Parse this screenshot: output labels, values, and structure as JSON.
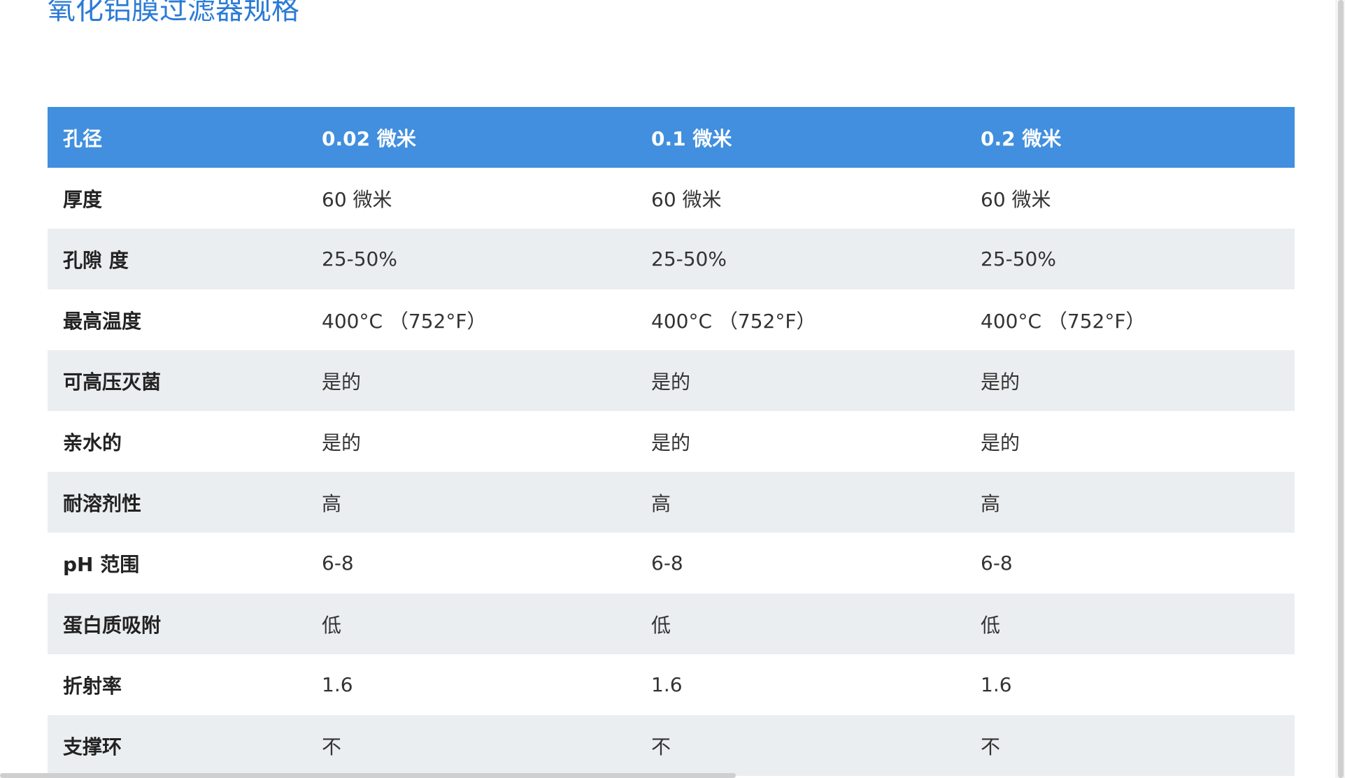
{
  "page": {
    "title": "氧化铝膜过滤器规格"
  },
  "table": {
    "header": [
      "孔径",
      "0.02 微米",
      "0.1 微米",
      "0.2 微米"
    ],
    "rows": [
      [
        "厚度",
        "60 微米",
        "60 微米",
        "60 微米"
      ],
      [
        "孔隙 度",
        "25-50%",
        "25-50%",
        "25-50%"
      ],
      [
        "最高温度",
        "400°C （752°F）",
        "400°C （752°F）",
        "400°C （752°F）"
      ],
      [
        "可高压灭菌",
        "是的",
        "是的",
        "是的"
      ],
      [
        "亲水的",
        "是的",
        "是的",
        "是的"
      ],
      [
        "耐溶剂性",
        "高",
        "高",
        "高"
      ],
      [
        "pH 范围",
        "6-8",
        "6-8",
        "6-8"
      ],
      [
        "蛋白质吸附",
        "低",
        "低",
        "低"
      ],
      [
        "折射率",
        "1.6",
        "1.6",
        "1.6"
      ],
      [
        "支撑环",
        "不",
        "不",
        "不"
      ]
    ]
  },
  "colors": {
    "title": "#2b7bd6",
    "header_bg": "#418fde",
    "header_text": "#ffffff",
    "row_alt_bg": "#ebeef0"
  }
}
